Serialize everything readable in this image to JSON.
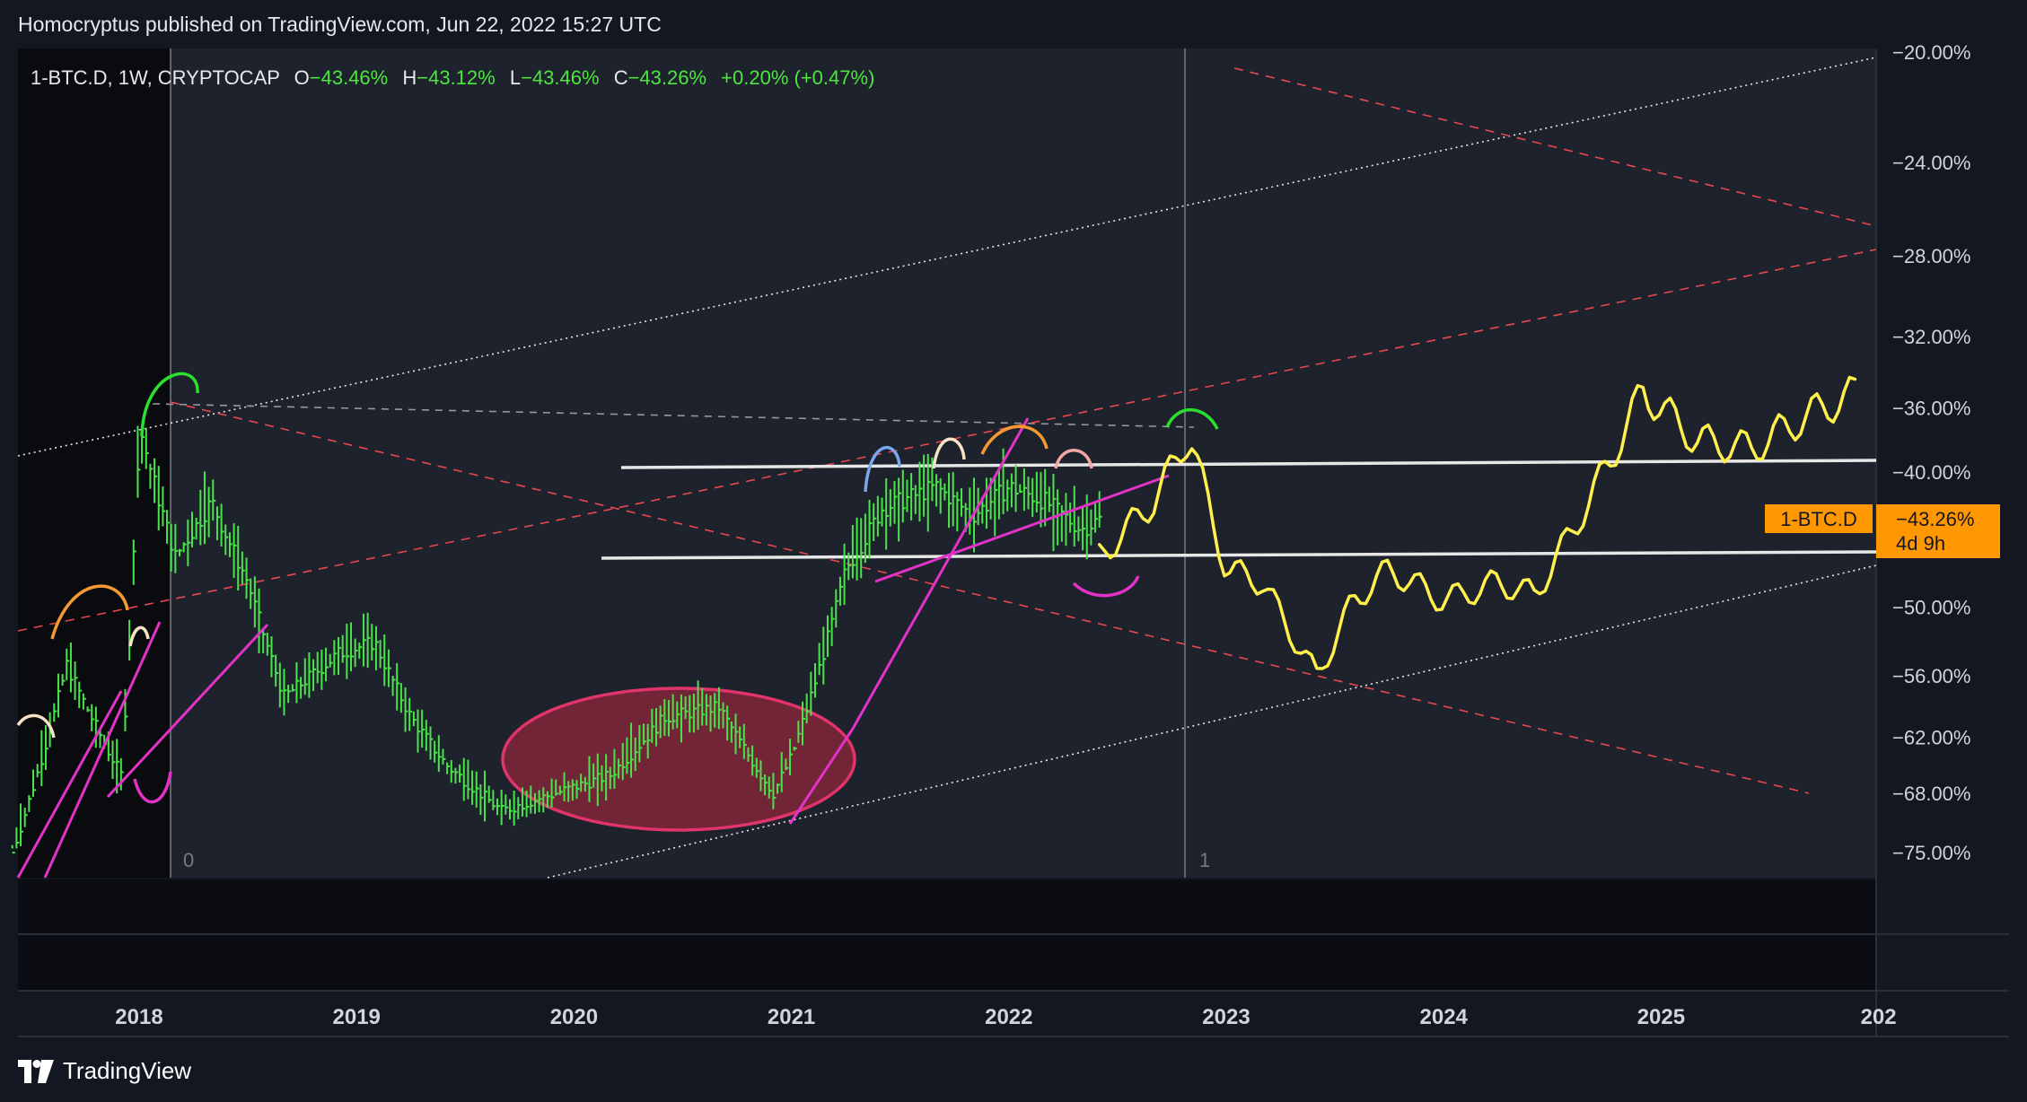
{
  "header": {
    "published": "Homocryptus published on TradingView.com, Jun 22, 2022 15:27 UTC"
  },
  "legend": {
    "symbol": "1-BTC.D, 1W, CRYPTOCAP",
    "o_label": "O",
    "o_value": "−43.46%",
    "h_label": "H",
    "h_value": "−43.12%",
    "l_label": "L",
    "l_value": "−43.46%",
    "c_label": "C",
    "c_value": "−43.26%",
    "change": "+0.20% (+0.47%)"
  },
  "price_tag": {
    "symbol": "1-BTC.D",
    "value": "−43.26%",
    "countdown": "4d 9h"
  },
  "markers": [
    "0",
    "1"
  ],
  "footer": {
    "brand": "TradingView"
  },
  "colors": {
    "background": "#131722",
    "pane": "#1e222d",
    "up": "#4be34b",
    "down": "#4be34b",
    "label_green": "#4ce63f",
    "projection": "#fff04b",
    "magenta": "#e332c8",
    "dashed_red": "#e8474f",
    "tag": "#ff9800",
    "ellipse": "#e0346a"
  },
  "chart_data": {
    "type": "line",
    "title": "1-BTC.D, 1W, CRYPTOCAP",
    "y_scale": "logarithmic (inverted dominance)",
    "y_ticks": [
      "−20.00%",
      "−24.00%",
      "−28.00%",
      "−32.00%",
      "−36.00%",
      "−40.00%",
      "−50.00%",
      "−56.00%",
      "−62.00%",
      "−68.00%",
      "−75.00%"
    ],
    "x_ticks": [
      "2018",
      "2019",
      "2020",
      "2021",
      "2022",
      "2023",
      "2024",
      "2025",
      "202"
    ],
    "last_value": -43.26,
    "series": [
      {
        "name": "1-BTC.D",
        "x": [
          "2017-06",
          "2017-09",
          "2017-12",
          "2018-01",
          "2018-03",
          "2018-05",
          "2018-07",
          "2018-09",
          "2018-12",
          "2019-02",
          "2019-04",
          "2019-06",
          "2019-09",
          "2019-12",
          "2020-03",
          "2020-06",
          "2020-09",
          "2020-12",
          "2021-01",
          "2021-04",
          "2021-06",
          "2021-09",
          "2021-11",
          "2022-01",
          "2022-03",
          "2022-05",
          "2022-06"
        ],
        "values": [
          -75.0,
          -55.0,
          -66.0,
          -37.0,
          -46.0,
          -42.0,
          -48.0,
          -58.0,
          -54.0,
          -53.0,
          -60.0,
          -65.0,
          -70.0,
          -68.0,
          -66.0,
          -60.0,
          -59.0,
          -68.0,
          -64.0,
          -47.0,
          -42.5,
          -41.0,
          -43.0,
          -41.0,
          -42.0,
          -44.0,
          -43.26
        ]
      },
      {
        "x": [
          "2022-06",
          "2022-09",
          "2022-11",
          "2023-01",
          "2023-03",
          "2023-06",
          "2023-08",
          "2023-10",
          "2024-01",
          "2024-04",
          "2024-06",
          "2024-09",
          "2024-12",
          "2025-03",
          "2025-06",
          "2025-09",
          "2025-12"
        ],
        "values": [
          -46.0,
          -42.0,
          -37.5,
          -47.0,
          -48.0,
          -56.0,
          -49.5,
          -47.0,
          -49.5,
          -48.0,
          -49.0,
          -42.0,
          -35.0,
          -38.0,
          -38.5,
          -36.5,
          -35.0
        ]
      }
    ]
  }
}
